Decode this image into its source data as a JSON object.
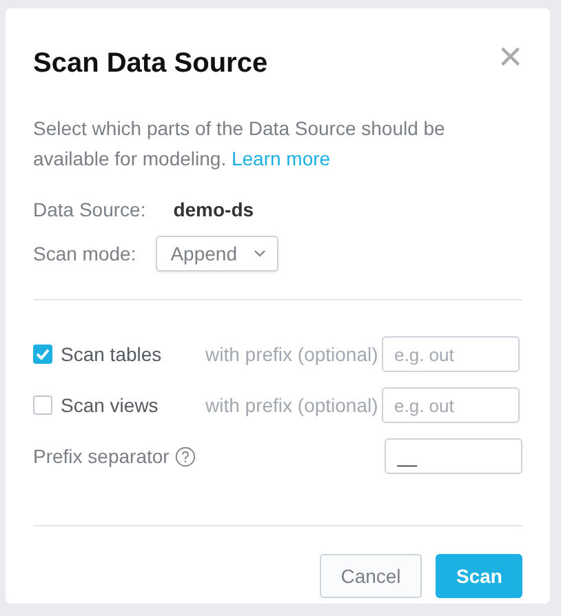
{
  "dialog": {
    "title": "Scan Data Source",
    "close": "×"
  },
  "description": {
    "text": "Select which parts of the Data Source should be available for modeling.",
    "link": "Learn more"
  },
  "data_source": {
    "label": "Data Source:",
    "value": "demo-ds"
  },
  "scan_mode": {
    "label": "Scan mode:",
    "value": "Append"
  },
  "options": [
    {
      "label": "Scan tables",
      "checked": true,
      "prefix_label": "with prefix (optional)",
      "placeholder": "e.g. out"
    },
    {
      "label": "Scan views",
      "checked": false,
      "prefix_label": "with prefix (optional)",
      "placeholder": "e.g. out"
    }
  ],
  "separator": {
    "label": "Prefix separator",
    "value": "__"
  },
  "buttons": [
    {
      "label": "Cancel",
      "kind": "secondary"
    },
    {
      "label": "Scan",
      "kind": "primary"
    }
  ]
}
